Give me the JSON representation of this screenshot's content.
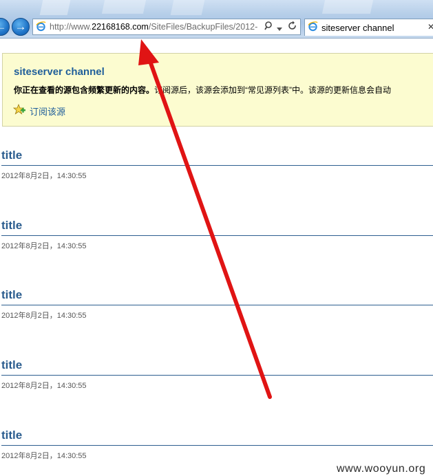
{
  "browser": {
    "url_prefix": "http://www.",
    "url_domain": "22168168.com",
    "url_path": "/SiteFiles/BackupFiles/2012-",
    "tab_title": "siteserver channel",
    "back_icon": "arrow-left-icon",
    "forward_icon": "arrow-right-icon",
    "search_icon": "magnifier-icon",
    "dropdown_icon": "chevron-down-icon",
    "refresh_icon": "refresh-icon",
    "close_icon": "close-icon"
  },
  "feed": {
    "title": "siteserver channel",
    "desc_bold": "你正在查看的源包含频繁更新的内容。",
    "desc_rest": "订阅源后，该源会添加到“常见源列表”中。该源的更新信息会自动",
    "subscribe_label": "订阅该源",
    "subscribe_icon": "star-plus-icon"
  },
  "entries": [
    {
      "title": "title",
      "date": "2012年8月2日，14:30:55"
    },
    {
      "title": "title",
      "date": "2012年8月2日，14:30:55"
    },
    {
      "title": "title",
      "date": "2012年8月2日，14:30:55"
    },
    {
      "title": "title",
      "date": "2012年8月2日，14:30:55"
    },
    {
      "title": "title",
      "date": "2012年8月2日，14:30:55"
    }
  ],
  "annotation": {
    "color": "#e01414",
    "icon": "red-arrow-pointer"
  },
  "watermark": "www.wooyun.org"
}
